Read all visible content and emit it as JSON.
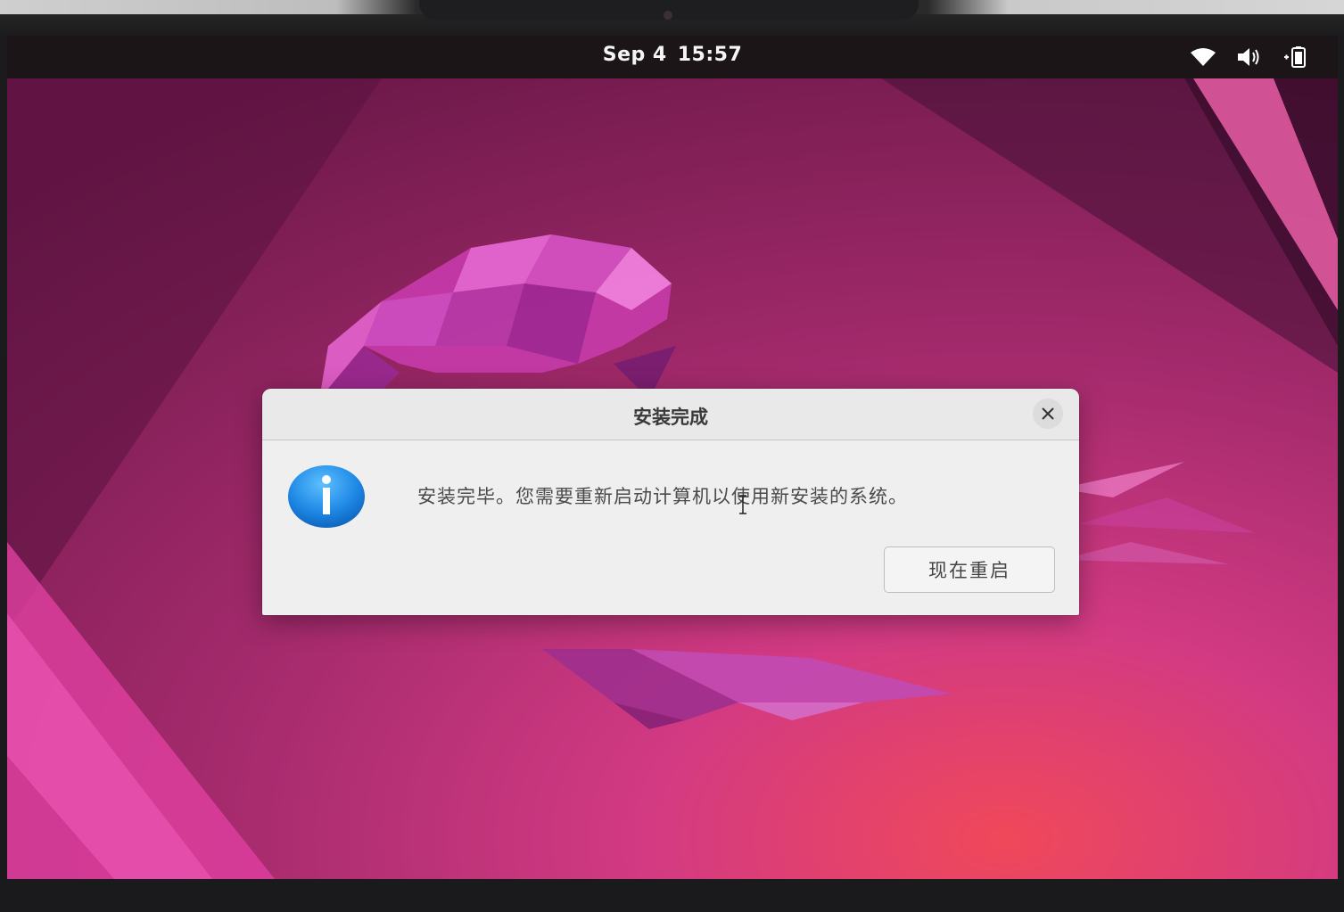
{
  "topbar": {
    "date": "Sep 4",
    "time": "15:57",
    "icons": [
      "wifi-icon",
      "volume-icon",
      "battery-icon"
    ]
  },
  "dialog": {
    "title": "安装完成",
    "message": "安装完毕。您需要重新启动计算机以使用新安装的系统。",
    "restart_label": "现在重启",
    "icon": "info-icon",
    "close_icon": "close-icon"
  },
  "colors": {
    "wallpaper_base": "#8a1f5a",
    "wallpaper_accent": "#e04a8f",
    "info_icon": "#1e88e5",
    "dialog_bg": "#efefef",
    "topbar_bg": "#1b1517"
  }
}
